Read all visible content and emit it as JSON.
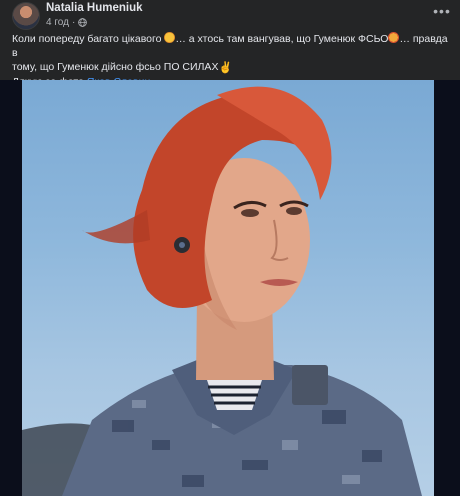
{
  "post": {
    "author": "Natalia Humeniuk",
    "time": "4 год",
    "separator": "·",
    "privacy_icon": "globe-icon",
    "more_label": "•••",
    "text_line1_part1": "Коли попереду багато цікавого ",
    "text_line1_part2": "… а хтось там вангував, що Гуменюк ФСЬО",
    "text_line1_part3": "… правда в",
    "text_line2": "тому, що Гуменюк дійсно фсьо ПО СИЛАХ",
    "text_line3_prefix": "Дякую за фото ",
    "text_line3_link": "Яков Славин",
    "emoji_1": "flushed-face",
    "emoji_2": "angry-face",
    "emoji_3": "victory-hand",
    "emoji_3_glyph": "✌"
  },
  "colors": {
    "background": "#242526",
    "page": "#18191a",
    "text": "#e4e6eb",
    "muted": "#b0b3b8",
    "link": "#4599ff"
  }
}
